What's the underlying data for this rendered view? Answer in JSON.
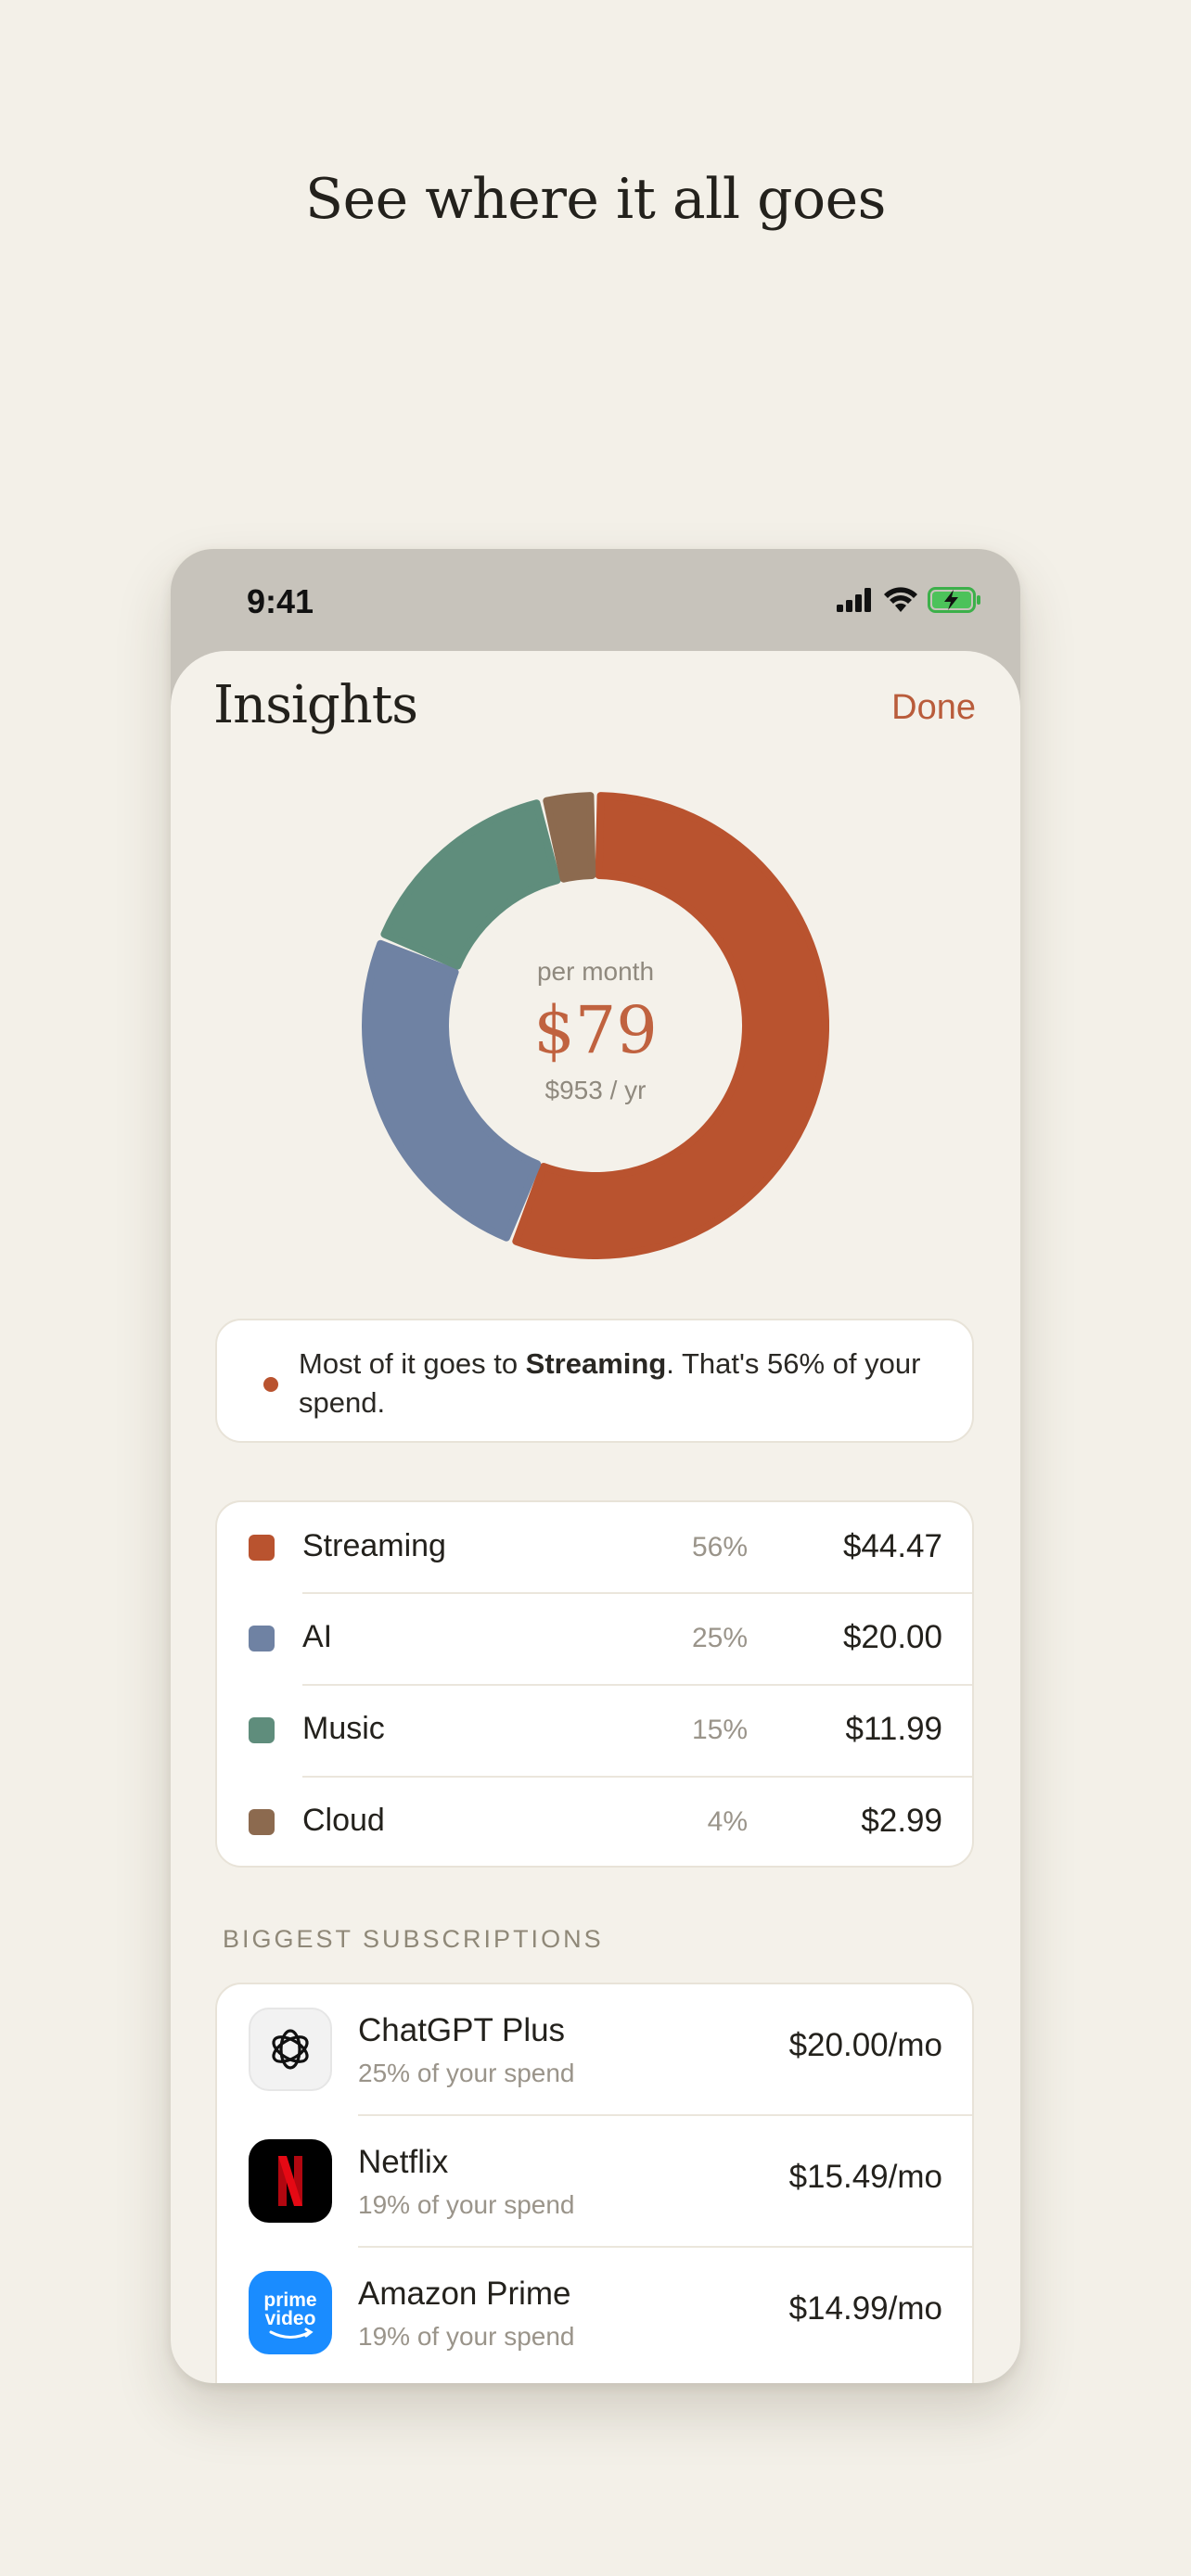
{
  "headline": "See where it all goes",
  "status": {
    "time": "9:41"
  },
  "header": {
    "title": "Insights",
    "done_label": "Done"
  },
  "summary": {
    "per_month_label": "per month",
    "amount": "$79",
    "per_year": "$953 / yr"
  },
  "insight": {
    "prefix": "Most of it goes to ",
    "highlight": "Streaming",
    "suffix": ". That's 56% of your spend."
  },
  "chart_data": {
    "type": "pie",
    "categories": [
      "Streaming",
      "AI",
      "Music",
      "Cloud"
    ],
    "values": [
      44.47,
      20.0,
      11.99,
      2.99
    ],
    "percent": [
      56,
      25,
      15,
      4
    ],
    "colors": [
      "#b9532f",
      "#6f82a3",
      "#5f8d7c",
      "#8c6a4f"
    ]
  },
  "categories": [
    {
      "name": "Streaming",
      "pct": "56%",
      "amount": "$44.47",
      "color": "#b9532f"
    },
    {
      "name": "AI",
      "pct": "25%",
      "amount": "$20.00",
      "color": "#6f82a3"
    },
    {
      "name": "Music",
      "pct": "15%",
      "amount": "$11.99",
      "color": "#5f8d7c"
    },
    {
      "name": "Cloud",
      "pct": "4%",
      "amount": "$2.99",
      "color": "#8c6a4f"
    }
  ],
  "subscriptions_header": "BIGGEST SUBSCRIPTIONS",
  "subscriptions": [
    {
      "name": "ChatGPT Plus",
      "share": "25% of your spend",
      "amount": "$20.00/mo",
      "icon": "openai-logo-icon"
    },
    {
      "name": "Netflix",
      "share": "19% of your spend",
      "amount": "$15.49/mo",
      "icon": "netflix-logo-icon"
    },
    {
      "name": "Amazon Prime",
      "share": "19% of your spend",
      "amount": "$14.99/mo",
      "icon": "prime-video-logo-icon",
      "icon_text_1": "prime",
      "icon_text_2": "video"
    }
  ]
}
